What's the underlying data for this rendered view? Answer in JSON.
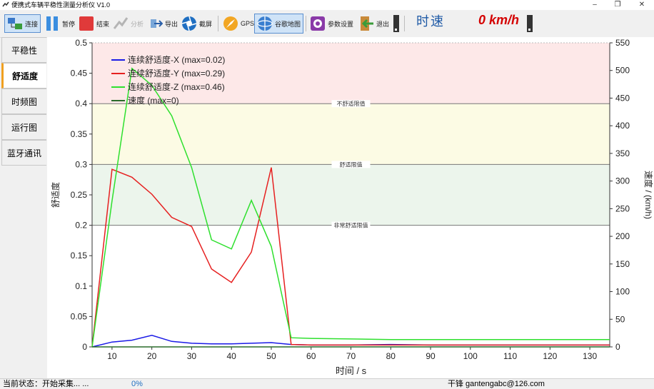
{
  "window": {
    "title": "便携式车辆平稳性测量分析仪 V1.0",
    "minimize": "–",
    "maximize": "❐",
    "close": "✕"
  },
  "toolbar": {
    "connect": "连接",
    "pause": "暂停",
    "stop": "结束",
    "analyze": "分析",
    "export": "导出",
    "screenshot": "截屏",
    "gps": "GPS",
    "google_map": "谷歌地图",
    "settings": "参数设置",
    "exit": "退出",
    "speed_label": "时速",
    "speed_value": "0 km/h"
  },
  "side_tabs": [
    "平稳性",
    "舒适度",
    "时频图",
    "运行图",
    "蓝牙通讯"
  ],
  "selected_tab": "舒适度",
  "status": {
    "state": "当前状态：开始采集... ...",
    "progress": "0%",
    "author": "干锋 gantengabc@126.com"
  },
  "chart_data": {
    "type": "line",
    "xlabel": "时间 / s",
    "ylabel": "舒适度",
    "y2label": "速度 / (km/h)",
    "xlim": [
      5,
      135
    ],
    "ylim": [
      0,
      0.5
    ],
    "y2lim": [
      0,
      550
    ],
    "xticks": [
      10,
      20,
      30,
      40,
      50,
      60,
      70,
      80,
      90,
      100,
      110,
      120,
      130
    ],
    "yticks": [
      0,
      0.05,
      0.1,
      0.15,
      0.2,
      0.25,
      0.3,
      0.35,
      0.4,
      0.45,
      0.5
    ],
    "y2ticks": [
      0,
      50,
      100,
      150,
      200,
      250,
      300,
      350,
      400,
      450,
      500,
      550
    ],
    "legend_position": "top-left",
    "bands": [
      {
        "from": 0.4,
        "to": 0.5,
        "color": "#fde8e8"
      },
      {
        "from": 0.3,
        "to": 0.4,
        "color": "#fcfbe4"
      },
      {
        "from": 0.2,
        "to": 0.3,
        "color": "#ecf5ec"
      }
    ],
    "thresholds": [
      {
        "y": 0.4,
        "label": "不舒适限值"
      },
      {
        "y": 0.3,
        "label": "舒适限值"
      },
      {
        "y": 0.2,
        "label": "非常舒适限值"
      }
    ],
    "series": [
      {
        "name": "连续舒适度-X (max=0.02)",
        "color": "#1a1ae6",
        "axis": "left",
        "x": [
          5,
          10,
          15,
          20,
          25,
          30,
          35,
          40,
          45,
          50,
          55,
          60,
          70,
          80,
          90,
          100,
          110,
          120,
          135
        ],
        "y": [
          0,
          0.008,
          0.011,
          0.019,
          0.009,
          0.006,
          0.005,
          0.005,
          0.006,
          0.007,
          0.004,
          0.003,
          0.003,
          0.004,
          0.003,
          0.003,
          0.003,
          0.003,
          0.003
        ]
      },
      {
        "name": "连续舒适度-Y (max=0.29)",
        "color": "#e62020",
        "axis": "left",
        "x": [
          5,
          10,
          15,
          20,
          25,
          30,
          35,
          40,
          45,
          50,
          55,
          60,
          70,
          80,
          90,
          100,
          110,
          120,
          135
        ],
        "y": [
          0,
          0.292,
          0.279,
          0.251,
          0.213,
          0.198,
          0.128,
          0.106,
          0.156,
          0.295,
          0.004,
          0.003,
          0.003,
          0.003,
          0.003,
          0.003,
          0.003,
          0.003,
          0.003
        ]
      },
      {
        "name": "连续舒适度-Z (max=0.46)",
        "color": "#2ee02e",
        "axis": "left",
        "x": [
          5,
          10,
          15,
          20,
          25,
          30,
          35,
          40,
          45,
          50,
          55,
          60,
          70,
          80,
          90,
          100,
          110,
          120,
          130,
          135
        ],
        "y": [
          0,
          0.24,
          0.458,
          0.43,
          0.38,
          0.295,
          0.176,
          0.161,
          0.241,
          0.165,
          0.015,
          0.014,
          0.013,
          0.012,
          0.012,
          0.012,
          0.012,
          0.012,
          0.012,
          0.012
        ]
      },
      {
        "name": "速度 (max=0)",
        "color": "#2a6b2a",
        "axis": "right",
        "x": [
          5,
          135
        ],
        "y": [
          0,
          0
        ]
      }
    ]
  }
}
